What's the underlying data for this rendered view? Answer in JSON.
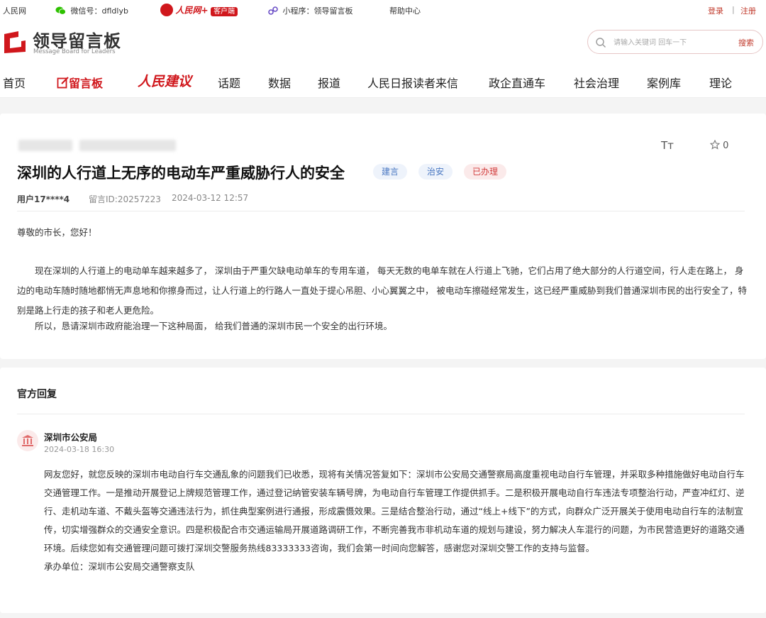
{
  "topbar": {
    "site": "人民网",
    "wechat": "微信号：dfldlyb",
    "app_brand": "人民网+",
    "app_badge": "客户端",
    "miniprogram": "小程序：领导留言板",
    "help": "帮助中心",
    "login": "登录",
    "sep": "|",
    "register": "注册"
  },
  "header": {
    "logo_title": "领导留言板",
    "logo_sub": "Message Board for Leaders",
    "search_placeholder": "请输入关键词 回车一下",
    "search_button": "搜索"
  },
  "nav": [
    "首页",
    "留言板",
    "人民建议",
    "话题",
    "数据",
    "报道",
    "人民日报读者来信",
    "政企直通车",
    "社会治理",
    "案例库",
    "理论"
  ],
  "post": {
    "title": "深圳的人行道上无序的电动车严重威胁行人的安全",
    "tags": [
      "建言",
      "治安",
      "已办理"
    ],
    "font_toggle": "Tт",
    "favorites": "0",
    "user": "用户17****4",
    "msg_id": "留言ID:20257223",
    "time": "2024-03-12 12:57",
    "greeting": "尊敬的市长，您好！",
    "paragraph1": "现在深圳的人行道上的电动单车越来越多了， 深圳由于严重欠缺电动单车的专用车道， 每天无数的电单车就在人行道上飞驰，它们占用了绝大部分的人行道空间，行人走在路上， 身边的电动车随时随地都悄无声息地和你擦身而过，让人行道上的行路人一直处于提心吊胆、小心翼翼之中， 被电动车擦碰经常发生，这已经严重威胁到我们普通深圳市民的出行安全了，特别是路上行走的孩子和老人更危险。",
    "paragraph2": "所以，恳请深圳市政府能治理一下这种局面， 给我们普通的深圳市民一个安全的出行环境。"
  },
  "reply": {
    "heading": "官方回复",
    "org": "深圳市公安局",
    "time": "2024-03-18 16:30",
    "content": "网友您好，就您反映的深圳市电动自行车交通乱象的问题我们已收悉，现将有关情况答复如下：深圳市公安局交通警察局高度重视电动自行车管理，并采取多种措施做好电动自行车交通管理工作。一是推动开展登记上牌规范管理工作，通过登记纳管安装车辆号牌，为电动自行车管理工作提供抓手。二是积极开展电动自行车违法专项整治行动，严查冲红灯、逆行、走机动车道、不戴头盔等交通违法行为，抓住典型案例进行通报，形成震慑效果。三是结合整治行动，通过“线上+线下”的方式，向群众广泛开展关于使用电动自行车的法制宣传，切实增强群众的交通安全意识。四是积极配合市交通运输局开展道路调研工作，不断完善我市非机动车道的规划与建设，努力解决人车混行的问题，为市民营造更好的道路交通环境。后续您如有交通管理问题可拨打深圳交警服务热线83333333咨询，我们会第一时间向您解答，感谢您对深圳交警工作的支持与监督。",
    "unit": "承办单位：深圳市公安局交通警察支队"
  },
  "colors": {
    "brand_red": "#d0171c",
    "tag_blue_bg": "#eef3fb",
    "tag_blue_fg": "#4a78c2",
    "tag_red_bg": "#fbeaea",
    "tag_red_fg": "#d23c3c"
  }
}
